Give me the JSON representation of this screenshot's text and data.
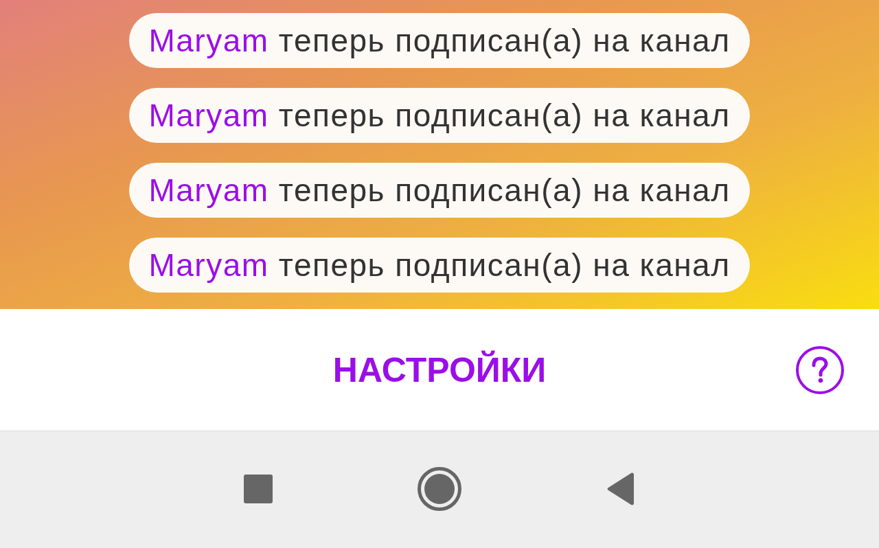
{
  "notifications": [
    {
      "user": "Maryam",
      "text": "теперь подписан(а) на канал"
    },
    {
      "user": "Maryam",
      "text": "теперь подписан(а) на канал"
    },
    {
      "user": "Maryam",
      "text": "теперь подписан(а) на канал"
    },
    {
      "user": "Maryam",
      "text": "теперь подписан(а) на канал"
    }
  ],
  "settings_button": {
    "label": "НАСТРОЙКИ"
  }
}
